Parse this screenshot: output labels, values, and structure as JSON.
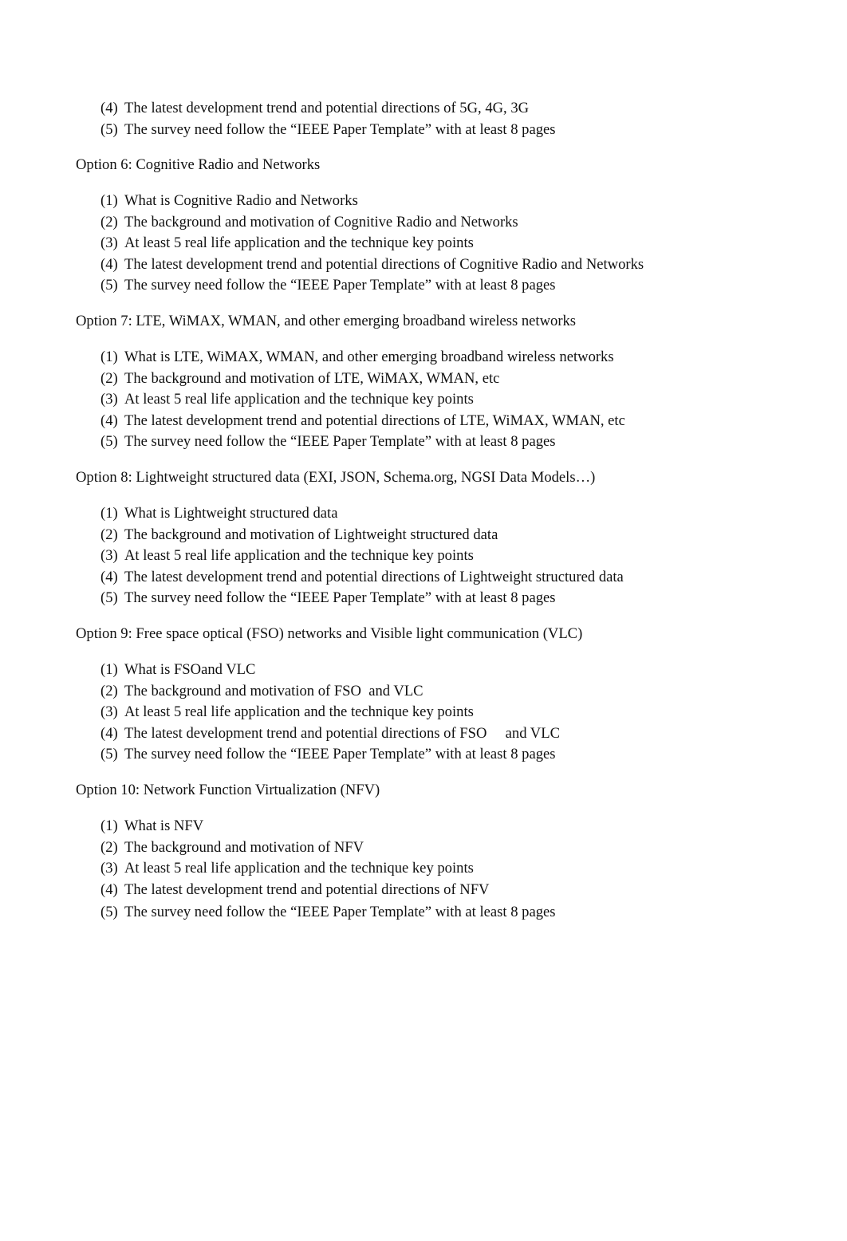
{
  "continuation": {
    "items": [
      {
        "num": "(4)",
        "text": "The latest development trend and potential directions of 5G, 4G, 3G"
      },
      {
        "num": "(5)",
        "text": "The survey need follow the “IEEE Paper Template” with at least 8 pages"
      }
    ]
  },
  "options": [
    {
      "heading": "Option 6: Cognitive Radio and Networks",
      "items": [
        {
          "num": "(1)",
          "text": "What is Cognitive Radio and Networks"
        },
        {
          "num": "(2)",
          "text": "The background and motivation of Cognitive Radio and Networks"
        },
        {
          "num": "(3)",
          "text": "At least 5 real life application and the technique key points"
        },
        {
          "num": "(4)",
          "text": "The latest development trend and potential directions of Cognitive Radio and Networks"
        },
        {
          "num": "(5)",
          "text": "The survey need follow the “IEEE Paper Template” with at least 8 pages"
        }
      ]
    },
    {
      "heading": "Option 7: LTE, WiMAX, WMAN, and other emerging broadband wireless networks",
      "items": [
        {
          "num": "(1)",
          "text": "What is LTE, WiMAX, WMAN, and other emerging broadband wireless networks"
        },
        {
          "num": "(2)",
          "text": "The background and motivation of LTE, WiMAX, WMAN, etc"
        },
        {
          "num": "(3)",
          "text": "At least 5 real life application and the technique key points"
        },
        {
          "num": "(4)",
          "text": "The latest development trend and potential directions of LTE, WiMAX, WMAN, etc"
        },
        {
          "num": "(5)",
          "text": "The survey need follow the “IEEE Paper Template” with at least 8 pages"
        }
      ]
    },
    {
      "heading": "Option 8: Lightweight structured data (EXI, JSON, Schema.org, NGSI Data Models…)",
      "items": [
        {
          "num": "(1)",
          "text": "What is Lightweight structured data"
        },
        {
          "num": "(2)",
          "text": "The background and motivation of Lightweight structured data"
        },
        {
          "num": "(3)",
          "text": "At least 5 real life application and the technique key points"
        },
        {
          "num": "(4)",
          "text": "The latest development trend and potential directions of Lightweight structured data"
        },
        {
          "num": "(5)",
          "text": "The survey need follow the “IEEE Paper Template” with at least 8 pages"
        }
      ]
    },
    {
      "heading": "Option 9: Free space optical (FSO) networks and Visible light communication (VLC)",
      "items": [
        {
          "num": "(1)",
          "text": "What is FSOand VLC"
        },
        {
          "num": "(2)",
          "text": "The background and motivation of FSO  and VLC"
        },
        {
          "num": "(3)",
          "text": "At least 5 real life application and the technique key points"
        },
        {
          "num": "(4)",
          "text": "The latest development trend and potential directions of FSO     and VLC"
        },
        {
          "num": "(5)",
          "text": "The survey need follow the “IEEE Paper Template” with at least 8 pages"
        }
      ]
    },
    {
      "heading": "Option 10: Network Function Virtualization (NFV)",
      "items": [
        {
          "num": "(1)",
          "text": "What is NFV"
        },
        {
          "num": "(2)",
          "text": "The background and motivation of NFV"
        },
        {
          "num": "(3)",
          "text": "At least 5 real life application and the technique key points"
        },
        {
          "num": "(4)",
          "text": "The latest development trend and potential directions of NFV"
        },
        {
          "num": "(5)",
          "text": "The survey need follow the “IEEE Paper Template” with at least 8 pages"
        }
      ]
    }
  ]
}
